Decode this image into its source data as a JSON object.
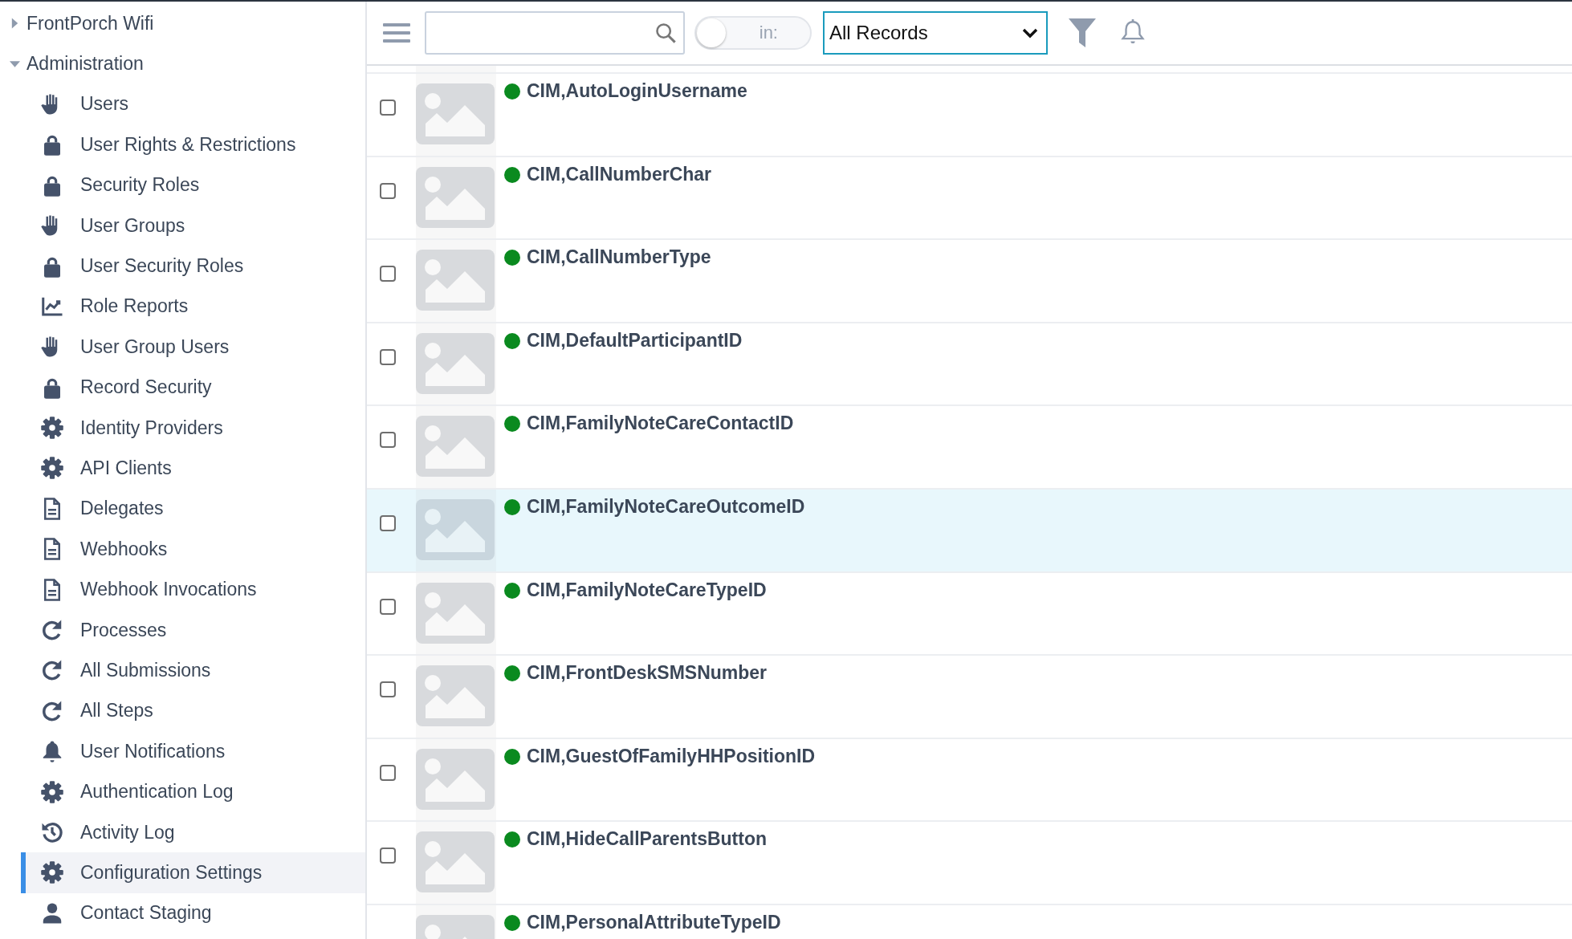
{
  "sidebar": {
    "groups": [
      {
        "label": "FrontPorch Wifi",
        "expanded": false
      },
      {
        "label": "Administration",
        "expanded": true,
        "children": [
          {
            "label": "Users",
            "kind": "hand",
            "selected": false
          },
          {
            "label": "User Rights & Restrictions",
            "kind": "lock",
            "selected": false
          },
          {
            "label": "Security Roles",
            "kind": "lock",
            "selected": false
          },
          {
            "label": "User Groups",
            "kind": "hand",
            "selected": false
          },
          {
            "label": "User Security Roles",
            "kind": "lock",
            "selected": false
          },
          {
            "label": "Role Reports",
            "kind": "chart",
            "selected": false
          },
          {
            "label": "User Group Users",
            "kind": "hand",
            "selected": false
          },
          {
            "label": "Record Security",
            "kind": "lock",
            "selected": false
          },
          {
            "label": "Identity Providers",
            "kind": "gear",
            "selected": false
          },
          {
            "label": "API Clients",
            "kind": "gear",
            "selected": false
          },
          {
            "label": "Delegates",
            "kind": "doc",
            "selected": false
          },
          {
            "label": "Webhooks",
            "kind": "doc",
            "selected": false
          },
          {
            "label": "Webhook Invocations",
            "kind": "doc",
            "selected": false
          },
          {
            "label": "Processes",
            "kind": "redo",
            "selected": false
          },
          {
            "label": "All Submissions",
            "kind": "redo",
            "selected": false
          },
          {
            "label": "All Steps",
            "kind": "redo",
            "selected": false
          },
          {
            "label": "User Notifications",
            "kind": "bell",
            "selected": false
          },
          {
            "label": "Authentication Log",
            "kind": "gear",
            "selected": false
          },
          {
            "label": "Activity Log",
            "kind": "history",
            "selected": false
          },
          {
            "label": "Configuration Settings",
            "kind": "gear",
            "selected": true
          },
          {
            "label": "Contact Staging",
            "kind": "user",
            "selected": false
          }
        ]
      }
    ]
  },
  "toolbar": {
    "toggle": {
      "label": "in:",
      "on": false
    },
    "select": {
      "value": "All Records"
    }
  },
  "rows": [
    {
      "name": "CIM,AutoLoginUsername",
      "color": "#0a8a1f",
      "checked": false,
      "selected": false
    },
    {
      "name": "CIM,CallNumberChar",
      "color": "#0a8a1f",
      "checked": false,
      "selected": false
    },
    {
      "name": "CIM,CallNumberType",
      "color": "#0a8a1f",
      "checked": false,
      "selected": false
    },
    {
      "name": "CIM,DefaultParticipantID",
      "color": "#0a8a1f",
      "checked": false,
      "selected": false
    },
    {
      "name": "CIM,FamilyNoteCareContactID",
      "color": "#0a8a1f",
      "checked": false,
      "selected": false
    },
    {
      "name": "CIM,FamilyNoteCareOutcomeID",
      "color": "#0a8a1f",
      "checked": false,
      "selected": true
    },
    {
      "name": "CIM,FamilyNoteCareTypeID",
      "color": "#0a8a1f",
      "checked": false,
      "selected": false
    },
    {
      "name": "CIM,FrontDeskSMSNumber",
      "color": "#0a8a1f",
      "checked": false,
      "selected": false
    },
    {
      "name": "CIM,GuestOfFamilyHHPositionID",
      "color": "#0a8a1f",
      "checked": false,
      "selected": false
    },
    {
      "name": "CIM,HideCallParentsButton",
      "color": "#0a8a1f",
      "checked": false,
      "selected": false
    },
    {
      "name": "CIM,PersonalAttributeTypeID",
      "color": "#0a8a1f",
      "selected": false
    }
  ]
}
